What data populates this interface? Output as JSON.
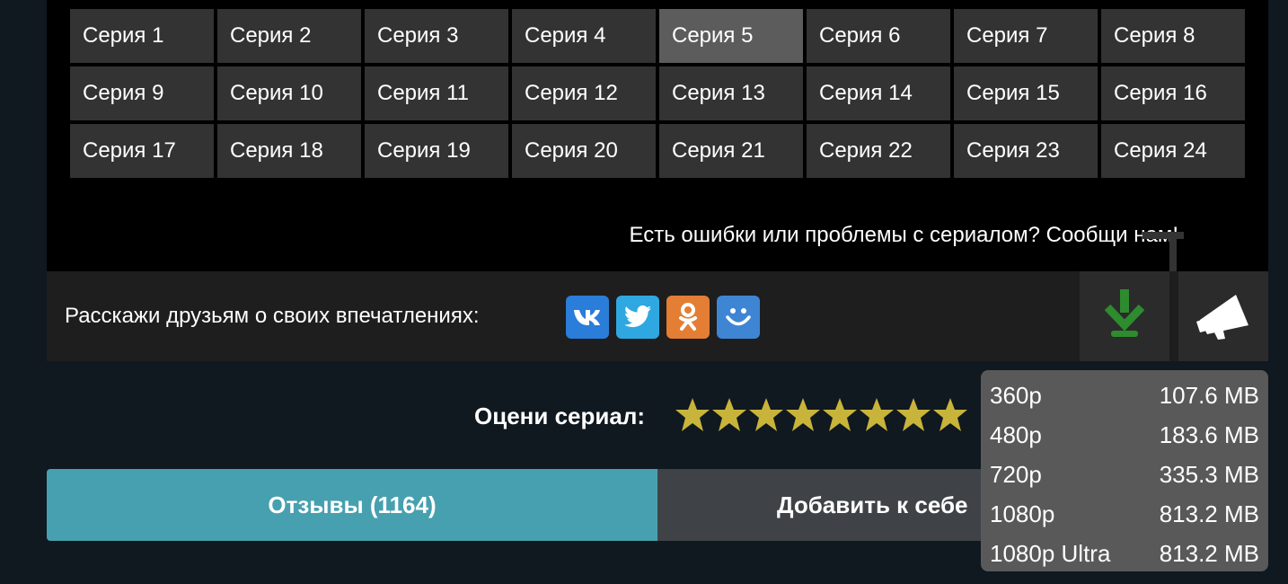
{
  "episodes": [
    "Серия 1",
    "Серия 2",
    "Серия 3",
    "Серия 4",
    "Серия 5",
    "Серия 6",
    "Серия 7",
    "Серия 8",
    "Серия 9",
    "Серия 10",
    "Серия 11",
    "Серия 12",
    "Серия 13",
    "Серия 14",
    "Серия 15",
    "Серия 16",
    "Серия 17",
    "Серия 18",
    "Серия 19",
    "Серия 20",
    "Серия 21",
    "Серия 22",
    "Серия 23",
    "Серия 24"
  ],
  "active_episode": "Серия 5",
  "report_text": "Есть ошибки или проблемы с сериалом? Сообщи нам!",
  "share": {
    "label": "Расскажи друзьям о своих впечатлениях:",
    "networks": [
      {
        "icon": "vk-icon",
        "color": "#2a7dd8"
      },
      {
        "icon": "twitter-icon",
        "color": "#2fa8e1"
      },
      {
        "icon": "odnoklassniki-icon",
        "color": "#e37e34"
      },
      {
        "icon": "moimir-icon",
        "color": "#3e86d4"
      }
    ]
  },
  "toolbar": {
    "download_icon": "download-icon",
    "announce_icon": "megaphone-icon",
    "download_color": "#2e8b2e"
  },
  "rating": {
    "label": "Оцени сериал:",
    "stars_visible": 8,
    "star_color": "#c8b43a"
  },
  "buttons": {
    "reviews": "Отзывы (1164)",
    "add": "Добавить к себе"
  },
  "download_menu": [
    {
      "quality": "360p",
      "size": "107.6 MB"
    },
    {
      "quality": "480p",
      "size": "183.6 MB"
    },
    {
      "quality": "720p",
      "size": "335.3 MB"
    },
    {
      "quality": "1080p",
      "size": "813.2 MB"
    },
    {
      "quality": "1080p Ultra",
      "size": "813.2 MB"
    }
  ]
}
